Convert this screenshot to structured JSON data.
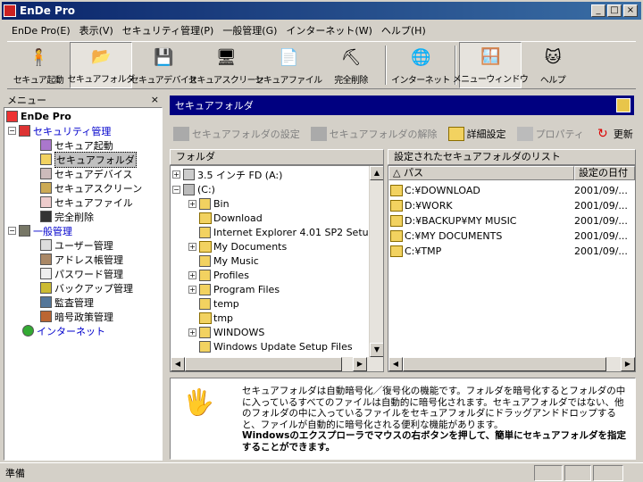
{
  "window": {
    "title": "EnDe Pro",
    "controls": [
      "_",
      "□",
      "×"
    ]
  },
  "menu": [
    "EnDe Pro(E)",
    "表示(V)",
    "セキュリティ管理(P)",
    "一般管理(G)",
    "インターネット(W)",
    "ヘルプ(H)"
  ],
  "toolbar": [
    {
      "label": "セキュア起動",
      "icon": "secure-boot-icon"
    },
    {
      "label": "セキュアフォルダ",
      "icon": "secure-folder-icon",
      "active": true
    },
    {
      "label": "セキュアデバイス",
      "icon": "secure-device-icon"
    },
    {
      "label": "セキュアスクリーン",
      "icon": "secure-screen-icon"
    },
    {
      "label": "セキュアファイル",
      "icon": "secure-file-icon"
    },
    {
      "label": "完全削除",
      "icon": "shovel-icon"
    },
    {
      "label": "インターネット",
      "icon": "internet-icon"
    },
    {
      "label": "メニューウィンドウ",
      "icon": "menu-window-icon"
    },
    {
      "label": "ヘルプ",
      "icon": "cat-help-icon"
    }
  ],
  "left_panel": {
    "title": "メニュー",
    "close": "×",
    "tree": [
      {
        "label": "EnDe Pro",
        "level": 0,
        "bold": true
      },
      {
        "label": "セキュリティ管理",
        "level": 1,
        "blue": true,
        "expander": "−"
      },
      {
        "label": "セキュア起動",
        "level": 2
      },
      {
        "label": "セキュアフォルダ",
        "level": 2,
        "selected": true
      },
      {
        "label": "セキュアデバイス",
        "level": 2
      },
      {
        "label": "セキュアスクリーン",
        "level": 2
      },
      {
        "label": "セキュアファイル",
        "level": 2
      },
      {
        "label": "完全削除",
        "level": 2
      },
      {
        "label": "一般管理",
        "level": 1,
        "blue": true,
        "expander": "−"
      },
      {
        "label": "ユーザー管理",
        "level": 2
      },
      {
        "label": "アドレス帳管理",
        "level": 2
      },
      {
        "label": "パスワード管理",
        "level": 2
      },
      {
        "label": "バックアップ管理",
        "level": 2
      },
      {
        "label": "監査管理",
        "level": 2
      },
      {
        "label": "暗号政策管理",
        "level": 2
      },
      {
        "label": "インターネット",
        "level": 1,
        "blue": true
      }
    ]
  },
  "right_panel": {
    "header": "セキュアフォルダ",
    "actions": [
      {
        "label": "セキュアフォルダの設定",
        "enabled": false
      },
      {
        "label": "セキュアフォルダの解除",
        "enabled": false
      },
      {
        "label": "詳細設定",
        "enabled": true
      },
      {
        "label": "プロパティ",
        "enabled": false
      },
      {
        "label": "更新",
        "enabled": true
      }
    ],
    "folder_header": "フォルダ",
    "folder_tree": [
      {
        "label": "3.5 インチ FD (A:)",
        "level": 0,
        "expander": "+"
      },
      {
        "label": "(C:)",
        "level": 0,
        "expander": "−"
      },
      {
        "label": "Bin",
        "level": 1,
        "expander": "+"
      },
      {
        "label": "Download",
        "level": 1,
        "locked": true
      },
      {
        "label": "Internet Explorer 4.01 SP2 Setup",
        "level": 1
      },
      {
        "label": "My Documents",
        "level": 1,
        "expander": "+",
        "locked": true
      },
      {
        "label": "My Music",
        "level": 1
      },
      {
        "label": "Profiles",
        "level": 1,
        "expander": "+"
      },
      {
        "label": "Program Files",
        "level": 1,
        "expander": "+"
      },
      {
        "label": "temp",
        "level": 1
      },
      {
        "label": "tmp",
        "level": 1,
        "locked": true
      },
      {
        "label": "WINDOWS",
        "level": 1,
        "expander": "+"
      },
      {
        "label": "Windows Update Setup Files",
        "level": 1
      }
    ],
    "list_header": "設定されたセキュアフォルダのリスト",
    "list_columns": [
      "パス",
      "設定の日付"
    ],
    "list_rows": [
      {
        "path": "C:¥DOWNLOAD",
        "date": "2001/09/..."
      },
      {
        "path": "D:¥WORK",
        "date": "2001/09/..."
      },
      {
        "path": "D:¥BACKUP¥MY MUSIC",
        "date": "2001/09/..."
      },
      {
        "path": "C:¥MY DOCUMENTS",
        "date": "2001/09/..."
      },
      {
        "path": "C:¥TMP",
        "date": "2001/09/..."
      }
    ],
    "info": {
      "text1": "セキュアフォルダは自動暗号化／復号化の機能です。フォルダを暗号化するとフォルダの中に入っているすべてのファイルは自動的に暗号化されます。セキュアフォルダではない、他のフォルダの中に入っているファイルをセキュアフォルダにドラッグアンドドロップすると、ファイルが自動的に暗号化される便利な機能があります。",
      "text2": "WindowsのエクスプローラでマウスのN右ボタンを押して、簡単にセキュアフォルダを指定することができます。"
    }
  },
  "status": {
    "text": "準備"
  }
}
